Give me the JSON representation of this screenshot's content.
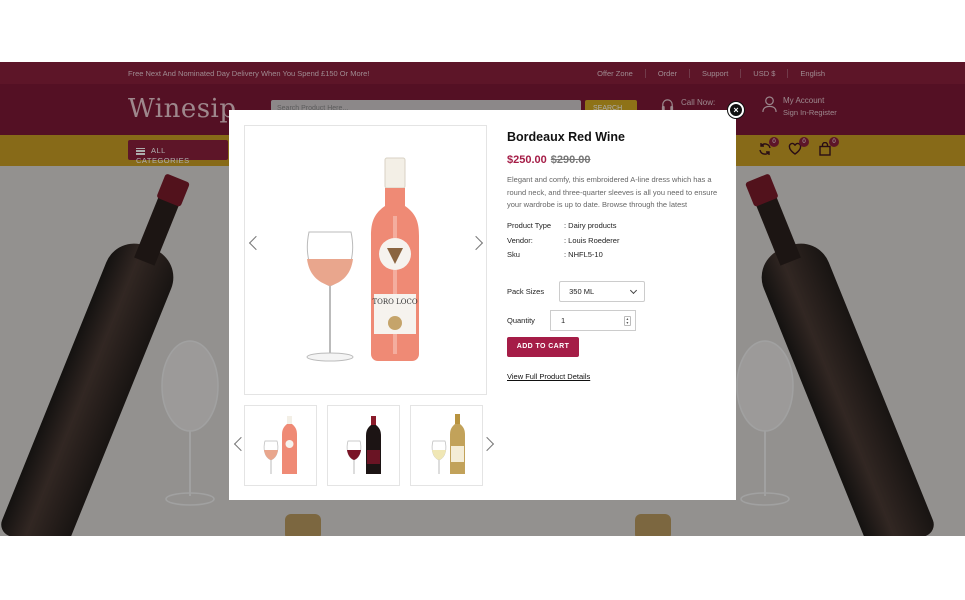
{
  "site": {
    "promo": "Free Next And Nominated Day Delivery When You Spend £150 Or More!",
    "top_links": [
      "Offer Zone",
      "Order",
      "Support",
      "USD $",
      "English"
    ],
    "logo": "Winesip",
    "search_placeholder": "Search Product Here...",
    "search_button": "SEARCH",
    "call_label": "Call Now:",
    "account_title": "My Account",
    "account_sub": "Sign In-Register",
    "categories_button": "ALL CATEGORIES",
    "badges": {
      "compare": "0",
      "wishlist": "0",
      "cart": "0"
    },
    "colors": {
      "topbar": "#8a1f3c",
      "header": "#7d1936",
      "catbar": "#c79d24",
      "accent": "#a51d47"
    }
  },
  "modal": {
    "title": "Bordeaux Red Wine",
    "price": "$250.00",
    "old_price": "$290.00",
    "description": "Elegant and comfy, this embroidered A-line dress which has a round neck, and three-quarter sleeves is all you need to ensure your wardrobe is up to date. Browse through the latest",
    "meta": [
      {
        "label": "Product Type",
        "value": ": Dairy products"
      },
      {
        "label": "Vendor:",
        "value": ": Louis Roederer"
      },
      {
        "label": "Sku",
        "value": ": NHFL5-10"
      }
    ],
    "pack_label": "Pack Sizes",
    "pack_value": "350 ML",
    "qty_label": "Quantity",
    "qty_value": "1",
    "add_to_cart": "ADD TO CART",
    "full_details": "View Full Product Details",
    "main_label": "TORO LOCO",
    "thumbs": [
      "rose-wine",
      "red-wine",
      "white-wine"
    ]
  }
}
